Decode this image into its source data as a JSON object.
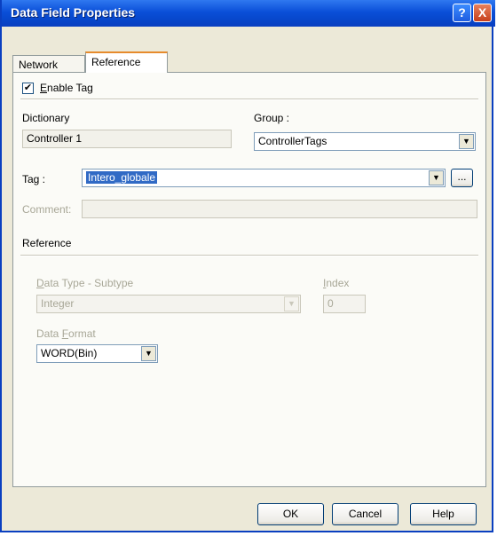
{
  "window": {
    "title": "Data Field Properties",
    "help_glyph": "?",
    "close_glyph": "X"
  },
  "tabs": [
    {
      "label": "Network"
    },
    {
      "label": "Reference"
    }
  ],
  "enable_tag": {
    "checked": true,
    "check_glyph": "✔",
    "label_first": "E",
    "label_rest": "nable Tag"
  },
  "dictionary": {
    "label": "Dictionary",
    "value": "Controller 1"
  },
  "group": {
    "label": "Group :",
    "value": "ControllerTags"
  },
  "tag": {
    "label": "Tag :",
    "value": "Intero_globale",
    "browse_label": "..."
  },
  "comment": {
    "label": "Comment:",
    "value": ""
  },
  "reference": {
    "section_label": "Reference",
    "data_type": {
      "label_first": "D",
      "label_rest": "ata Type - Subtype",
      "value": "Integer"
    },
    "index": {
      "label_first": "I",
      "label_rest": "ndex",
      "value": "0"
    },
    "data_format": {
      "label_first": "Data ",
      "label_underlined": "F",
      "label_rest": "ormat",
      "value": "WORD(Bin)"
    }
  },
  "buttons": {
    "ok": "OK",
    "cancel": "Cancel",
    "help": "Help"
  },
  "icons": {
    "dropdown": "▼"
  }
}
